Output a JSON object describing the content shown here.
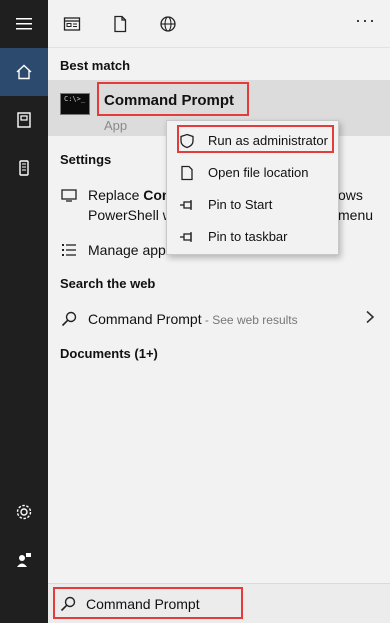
{
  "toolbar": {
    "more_label": "···"
  },
  "sections": {
    "best_match": "Best match",
    "settings": "Settings",
    "search_web": "Search the web",
    "documents": "Documents (1+)"
  },
  "best_match": {
    "title": "Command Prompt",
    "subtitle": "App",
    "thumb_text": "C:\\>_"
  },
  "settings": {
    "item1_pre": "Replace ",
    "item1_bold": "Com",
    "item1_tail": "ows",
    "item1_line2_pre": "PowerShell w",
    "item1_line2_tail": "menu",
    "item2": "Manage app"
  },
  "web": {
    "query": "Command Prompt",
    "suffix": " - See web results"
  },
  "context_menu": {
    "items": [
      {
        "label": "Run as administrator",
        "icon": "shield-icon"
      },
      {
        "label": "Open file location",
        "icon": "file-location-icon"
      },
      {
        "label": "Pin to Start",
        "icon": "pin-icon"
      },
      {
        "label": "Pin to taskbar",
        "icon": "pin-icon"
      }
    ]
  },
  "search": {
    "value": "Command Prompt"
  },
  "colors": {
    "rail": "#1f1f1f",
    "rail_active": "#2b4a6e",
    "highlight": "#e33c3c",
    "row_selected": "#dcdcdc"
  }
}
